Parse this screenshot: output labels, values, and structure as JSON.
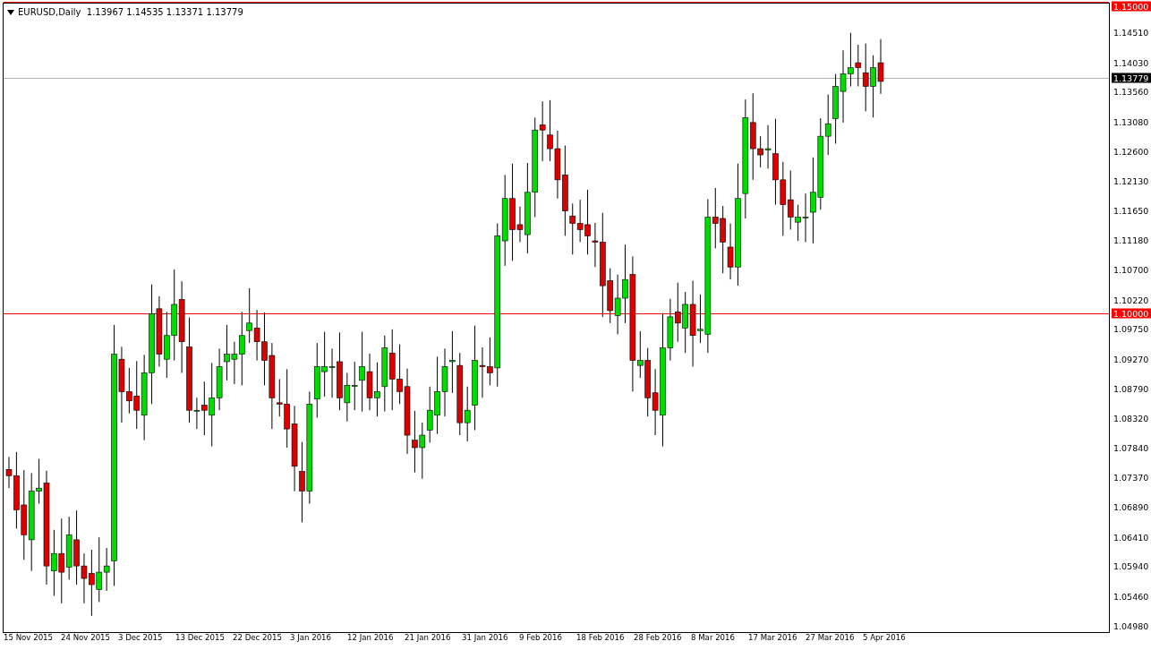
{
  "chart": {
    "title": "EURUSD,Daily  1.13967 1.14535 1.13371 1.13779",
    "price_labels": [
      "1.14510",
      "1.14030",
      "1.13560",
      "1.13080",
      "1.12600",
      "1.12130",
      "1.11650",
      "1.11180",
      "1.10700",
      "1.10220",
      "1.09750",
      "1.09270",
      "1.08790",
      "1.08320",
      "1.07840",
      "1.07370",
      "1.06890",
      "1.06410",
      "1.05940",
      "1.05460",
      "1.04980"
    ],
    "level_lines": [
      {
        "label": "1.15000",
        "kind": "level"
      },
      {
        "label": "1.13779",
        "kind": "bid"
      },
      {
        "label": "1.10000",
        "kind": "level"
      }
    ],
    "date_labels": [
      "15 Nov 2015",
      "24 Nov 2015",
      "3 Dec 2015",
      "13 Dec 2015",
      "22 Dec 2015",
      "3 Jan 2016",
      "12 Jan 2016",
      "21 Jan 2016",
      "31 Jan 2016",
      "9 Feb 2016",
      "18 Feb 2016",
      "28 Feb 2016",
      "8 Mar 2016",
      "17 Mar 2016",
      "27 Mar 2016",
      "5 Apr 2016"
    ]
  }
}
